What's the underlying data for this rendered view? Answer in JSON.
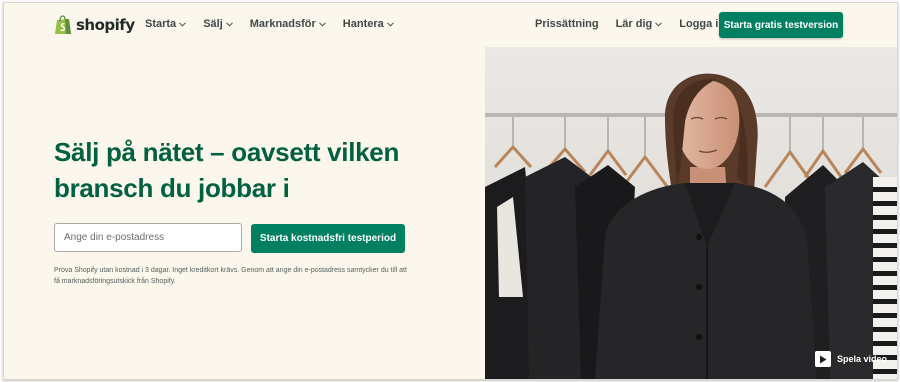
{
  "header": {
    "logo_text": "shopify",
    "nav_left": [
      {
        "label": "Starta"
      },
      {
        "label": "Sälj"
      },
      {
        "label": "Marknadsför"
      },
      {
        "label": "Hantera"
      }
    ],
    "nav_right": {
      "pricing": "Prissättning",
      "learn": "Lär dig",
      "login": "Logga in"
    },
    "cta_label": "Starta gratis testversion"
  },
  "hero": {
    "headline": "Sälj på nätet – oavsett vilken bransch du jobbar i",
    "email_placeholder": "Ange din e-postadress",
    "cta_label": "Starta kostnadsfri testperiod",
    "disclaimer": "Prova Shopify utan kostnad i 3 dagar. Inget kreditkort krävs. Genom att ange din e-postadress samtycker du till att få marknadsföringsutskick från Shopify.",
    "video_label": "Spela video"
  },
  "colors": {
    "brand_green": "#008060",
    "headline_green": "#00603f",
    "background": "#fbf7ed"
  },
  "icons": {
    "logo": "shopify-bag-icon",
    "dropdown": "chevron-down-icon",
    "video": "play-icon"
  }
}
